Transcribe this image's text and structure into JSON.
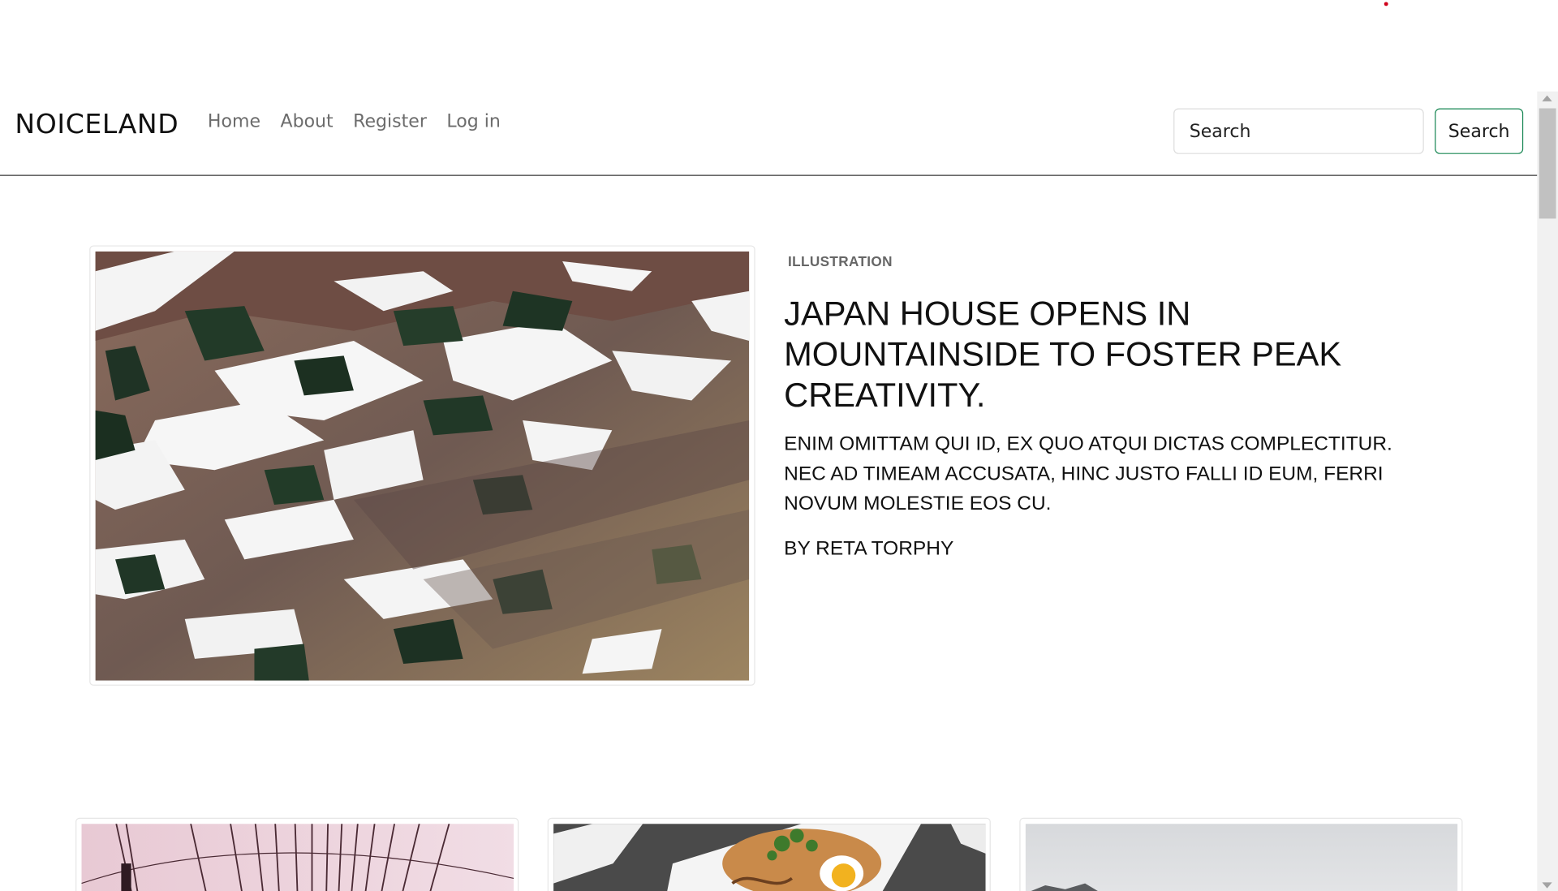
{
  "navbar": {
    "brand": "NOICELAND",
    "links": [
      "Home",
      "About",
      "Register",
      "Log in"
    ],
    "search_placeholder": "Search",
    "search_button": "Search"
  },
  "featured": {
    "category": "ILLUSTRATION",
    "title": "JAPAN HOUSE OPENS IN MOUNTAINSIDE TO FOSTER PEAK CREATIVITY.",
    "excerpt": "ENIM OMITTAM QUI ID, EX QUO ATQUI DICTAS COMPLECTITUR. NEC AD TIMEAM ACCUSATA, HINC JUSTO FALLI ID EUM, FERRI NOVUM MOLESTIE EOS CU.",
    "author": "BY RETA TORPHY",
    "image": "snowy-mountain-slope-photo"
  },
  "cards": [
    {
      "image": "bridge-cables-photo"
    },
    {
      "image": "food-plate-photo"
    },
    {
      "image": "misty-landscape-photo"
    }
  ],
  "colors": {
    "search_button_border": "#198754",
    "nav_link": "#6c6c6c",
    "text": "#111111"
  }
}
